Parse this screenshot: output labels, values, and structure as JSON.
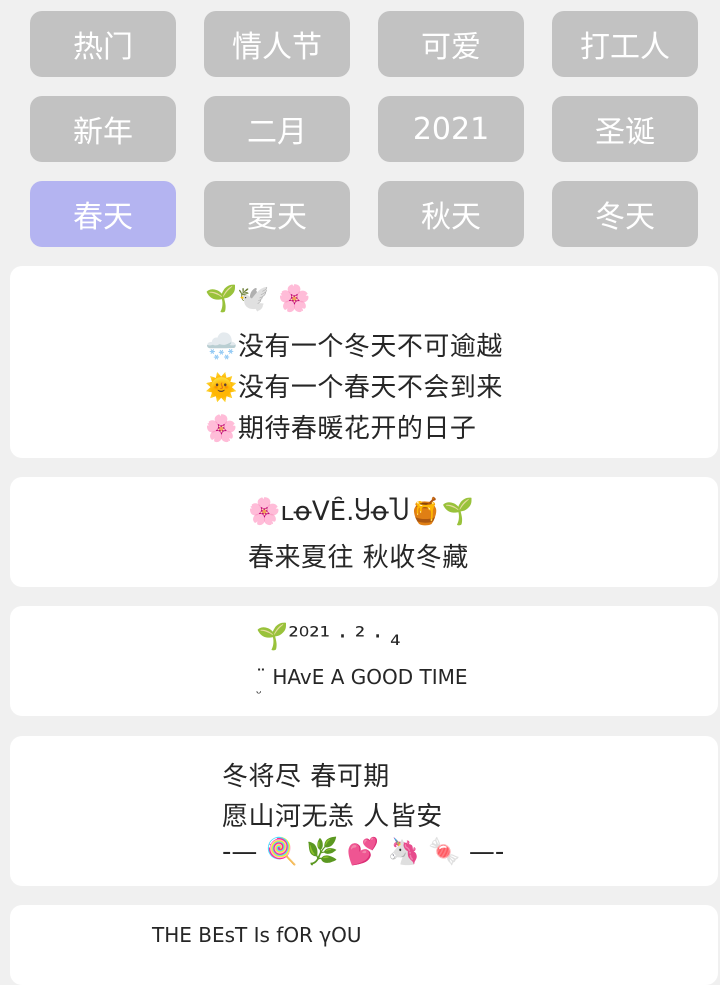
{
  "tags": [
    {
      "label": "热门",
      "selected": false
    },
    {
      "label": "情人节",
      "selected": false
    },
    {
      "label": "可爱",
      "selected": false
    },
    {
      "label": "打工人",
      "selected": false
    },
    {
      "label": "新年",
      "selected": false
    },
    {
      "label": "二月",
      "selected": false
    },
    {
      "label": "2021",
      "selected": false
    },
    {
      "label": "圣诞",
      "selected": false
    },
    {
      "label": "春天",
      "selected": true
    },
    {
      "label": "夏天",
      "selected": false
    },
    {
      "label": "秋天",
      "selected": false
    },
    {
      "label": "冬天",
      "selected": false
    }
  ],
  "colors": {
    "tag_bg": "#c2c2c2",
    "tag_selected_bg": "#b4b4f1",
    "tag_text": "#ffffff",
    "card_bg": "#ffffff",
    "page_bg": "#f0f0f0",
    "text": "#262626"
  },
  "cards": [
    {
      "line1": "🌱🕊️        🌸",
      "line2": "🌨️没有一个冬天不可逾越",
      "line3": "🌞没有一个春天不会到来",
      "line4": "🌸期待春暖花开的日子"
    },
    {
      "line1": "🌸ʟꝋᐯȆ.ႸꝋႮ🍯🌱",
      "line2": "春来夏往 秋收冬藏"
    },
    {
      "line1": "🌱²⁰²¹ · ² · ₄",
      "line2": "¨ HAvE A GOOD TIME",
      "line3": "ᵕ"
    },
    {
      "line1": "冬将尽 春可期",
      "line2": "愿山河无恙 人皆安",
      "line3": "-— 🍭 🌿 💕 🦄 🍬 —-"
    },
    {
      "line1": "THE BEsT Is fOR γOU"
    }
  ]
}
